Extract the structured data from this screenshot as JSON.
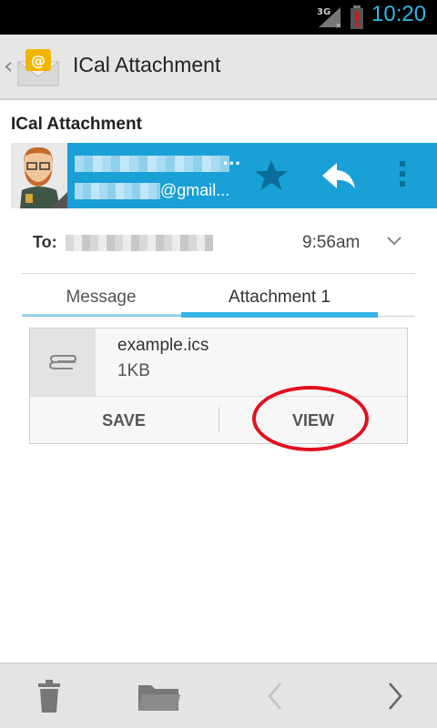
{
  "status_bar": {
    "network": "3G",
    "time": "10:20",
    "colors": {
      "time": "#33b5e5",
      "battery_alert": "#cc1a1a"
    }
  },
  "action_bar": {
    "title": "ICal Attachment",
    "back_icon": "chevron-left-icon",
    "app_icon": "email-app-icon"
  },
  "message": {
    "subject": "ICal Attachment",
    "sender": {
      "name_suffix": "...",
      "email_suffix": "@gmail..."
    },
    "sender_bar_color": "#19a0d6",
    "actions": [
      "star-icon",
      "reply-icon",
      "overflow-menu-icon"
    ],
    "to_label": "To:",
    "time": "9:56am"
  },
  "tabs": [
    {
      "label": "Message",
      "selected": false
    },
    {
      "label": "Attachment 1",
      "selected": true
    }
  ],
  "attachment": {
    "file_name": "example.ics",
    "file_size": "1KB",
    "save_label": "SAVE",
    "view_label": "VIEW",
    "icon": "paperclip-icon"
  },
  "bottom_bar": {
    "buttons": [
      "trash-icon",
      "folder-icon",
      "chevron-left-icon",
      "chevron-right-icon"
    ]
  }
}
